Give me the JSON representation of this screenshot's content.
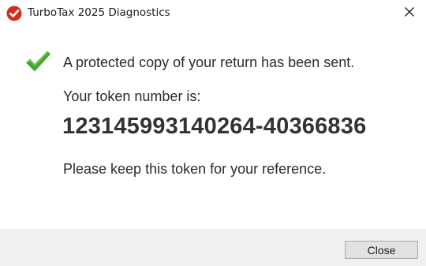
{
  "window": {
    "title": "TurboTax 2025 Diagnostics",
    "app_icon": "turbotax-check-logo-icon",
    "close_icon": "close-icon"
  },
  "message": {
    "status_icon": "green-checkmark-icon",
    "sent_text": "A protected copy of your return has been sent.",
    "token_label": "Your token number is:",
    "token_number": "123145993140264-40366836",
    "reference_text": "Please keep this token for your reference."
  },
  "footer": {
    "close_label": "Close"
  },
  "colors": {
    "logo_red": "#d52b1e",
    "check_green": "#43a62f",
    "footer_bg": "#f0f0f0",
    "button_bg": "#e1e1e1"
  }
}
